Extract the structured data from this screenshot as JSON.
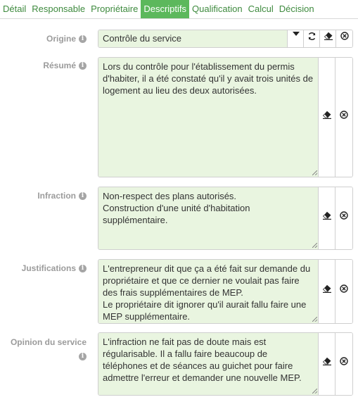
{
  "tabs": [
    {
      "label": "Détail",
      "active": false
    },
    {
      "label": "Responsable",
      "active": false
    },
    {
      "label": "Propriétaire",
      "active": false
    },
    {
      "label": "Descriptifs",
      "active": true
    },
    {
      "label": "Qualification",
      "active": false
    },
    {
      "label": "Calcul",
      "active": false
    },
    {
      "label": "Décision",
      "active": false
    }
  ],
  "colors": {
    "accent": "#5cb85c",
    "tab_text": "#3e8a3e",
    "field_bg": "#e9f5e0",
    "label": "#9b9b9b"
  },
  "origine": {
    "label": "Origine",
    "value": "Contrôle du service"
  },
  "resume": {
    "label": "Résumé",
    "value": "Lors du contrôle pour l'établissement du permis d'habiter, il a été constaté qu'il y avait trois unités de logement au lieu des deux autorisées."
  },
  "infraction": {
    "label": "Infraction",
    "value": "Non-respect des plans autorisés.\nConstruction d'une unité d'habitation supplémentaire."
  },
  "justifications": {
    "label": "Justifications",
    "value": "L'entrepreneur dit que ça a été fait sur demande du propriétaire et que ce dernier ne voulait pas faire des frais supplémentaires de MEP.\nLe propriétaire dit ignorer qu'il aurait fallu faire une MEP supplémentaire."
  },
  "opinion": {
    "label": "Opinion du service",
    "value": "L'infraction ne fait pas de doute mais est régularisable. Il a fallu faire beaucoup de téléphones et de séances au guichet pour faire admettre l'erreur et demander une nouvelle MEP."
  }
}
